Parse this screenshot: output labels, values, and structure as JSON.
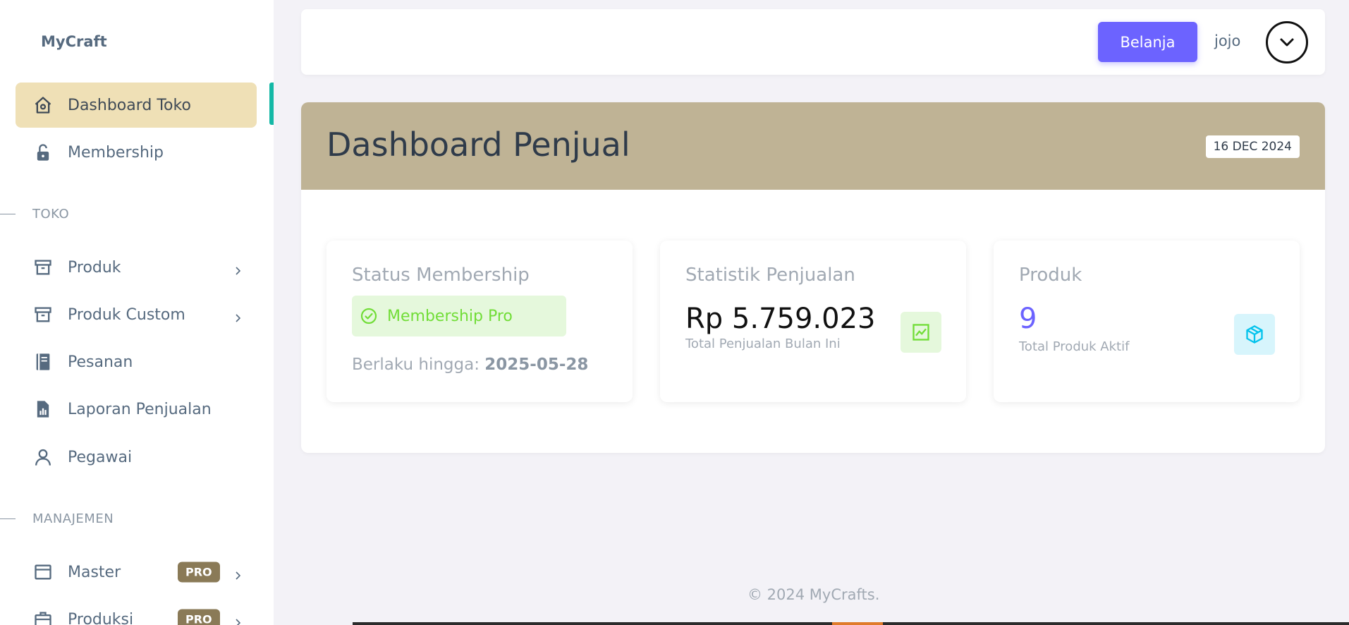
{
  "sidebar": {
    "brand": "MyCraft",
    "items": [
      {
        "label": "Dashboard Toko",
        "icon": "home-icon",
        "active": true
      },
      {
        "label": "Membership",
        "icon": "lock-open-icon"
      }
    ],
    "sections": [
      {
        "title": "TOKO",
        "items": [
          {
            "label": "Produk",
            "icon": "archive-icon",
            "has_submenu": true
          },
          {
            "label": "Produk Custom",
            "icon": "archive-icon",
            "has_submenu": true
          },
          {
            "label": "Pesanan",
            "icon": "book-icon"
          },
          {
            "label": "Laporan Penjualan",
            "icon": "report-file-icon"
          },
          {
            "label": "Pegawai",
            "icon": "user-icon"
          }
        ]
      },
      {
        "title": "MANAJEMEN",
        "items": [
          {
            "label": "Master",
            "icon": "window-icon",
            "badge": "PRO",
            "has_submenu": true
          },
          {
            "label": "Produksi",
            "icon": "briefcase-icon",
            "badge": "PRO",
            "has_submenu": true
          }
        ]
      }
    ]
  },
  "header": {
    "shop_button": "Belanja",
    "username": "jojo",
    "avatar_icon": "chevron-down-circle-icon"
  },
  "dashboard": {
    "title": "Dashboard Penjual",
    "date": "16 DEC 2024",
    "cards": {
      "membership": {
        "title": "Status Membership",
        "badge": "Membership Pro",
        "valid_label": "Berlaku hingga:",
        "valid_date": "2025-05-28"
      },
      "sales": {
        "title": "Statistik Penjualan",
        "value": "Rp 5.759.023",
        "label": "Total Penjualan Bulan Ini",
        "icon": "trend-chart-icon"
      },
      "products": {
        "title": "Produk",
        "value": "9",
        "label": "Total Produk Aktif",
        "icon": "cube-icon"
      }
    }
  },
  "footer": "© 2024 MyCrafts.",
  "colors": {
    "primary": "#6c63ff",
    "active_nav": "#efe0b6",
    "header_band": "#bfb395",
    "success": "#71dd37",
    "info": "#03c3ec",
    "pro_badge": "#8a7a57"
  }
}
